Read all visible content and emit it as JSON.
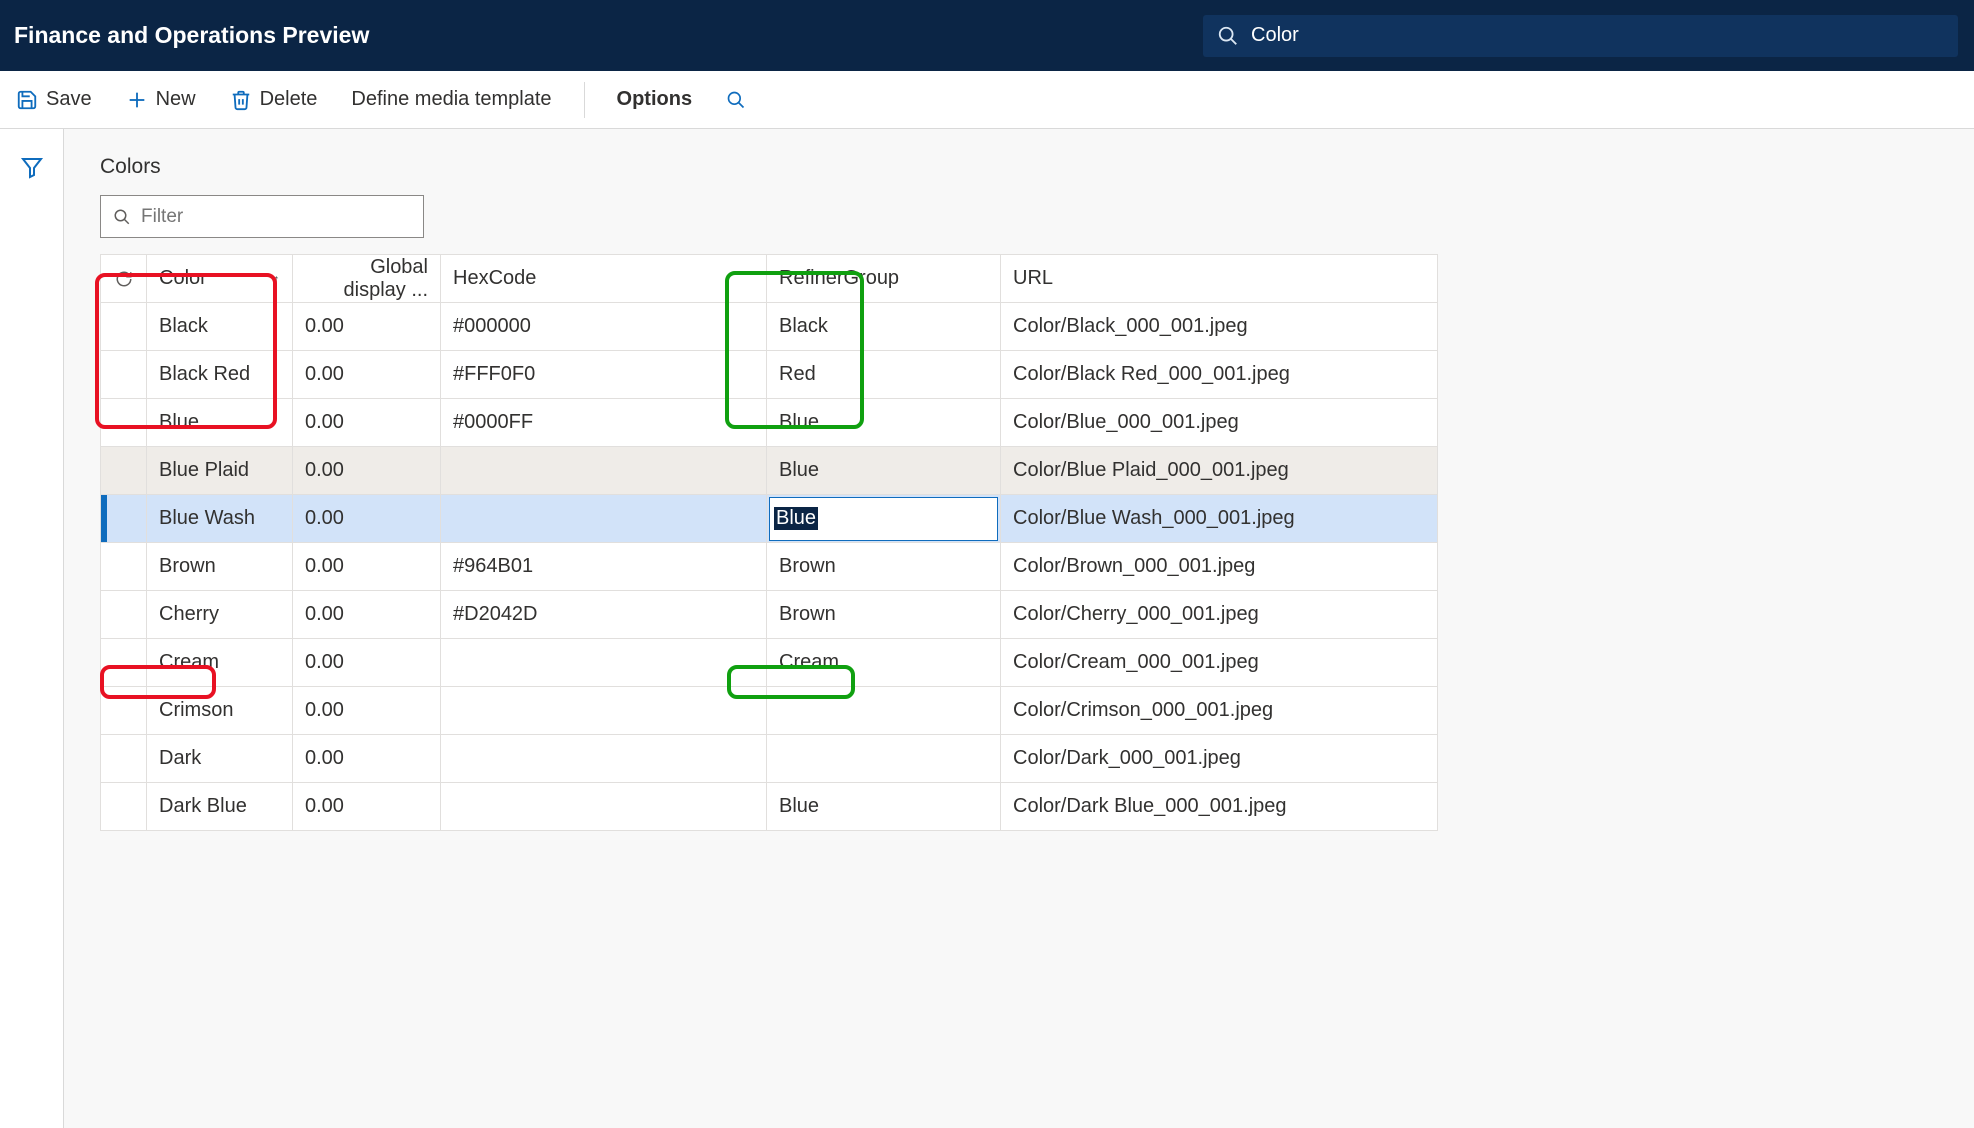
{
  "header": {
    "app_title": "Finance and Operations Preview",
    "search_value": "Color"
  },
  "cmdbar": {
    "save": "Save",
    "new": "New",
    "delete": "Delete",
    "define_media_template": "Define media template",
    "options": "Options"
  },
  "page": {
    "title": "Colors",
    "filter_placeholder": "Filter"
  },
  "grid": {
    "headers": {
      "color": "Color",
      "global_display": "Global display ...",
      "hexcode": "HexCode",
      "refiner_group": "RefinerGroup",
      "url": "URL"
    },
    "rows": [
      {
        "color": "Black",
        "disp": "0.00",
        "hex": "#000000",
        "refiner": "Black",
        "url": "Color/Black_000_001.jpeg"
      },
      {
        "color": "Black Red",
        "disp": "0.00",
        "hex": "#FFF0F0",
        "refiner": "Red",
        "url": "Color/Black Red_000_001.jpeg"
      },
      {
        "color": "Blue",
        "disp": "0.00",
        "hex": "#0000FF",
        "refiner": "Blue",
        "url": "Color/Blue_000_001.jpeg"
      },
      {
        "color": "Blue Plaid",
        "disp": "0.00",
        "hex": "",
        "refiner": "Blue",
        "url": "Color/Blue Plaid_000_001.jpeg",
        "alt": true
      },
      {
        "color": "Blue Wash",
        "disp": "0.00",
        "hex": "",
        "refiner": "Blue",
        "url": "Color/Blue Wash_000_001.jpeg",
        "selected": true,
        "editing": true
      },
      {
        "color": "Brown",
        "disp": "0.00",
        "hex": "#964B01",
        "refiner": "Brown",
        "url": "Color/Brown_000_001.jpeg"
      },
      {
        "color": "Cherry",
        "disp": "0.00",
        "hex": "#D2042D",
        "refiner": "Brown",
        "url": "Color/Cherry_000_001.jpeg"
      },
      {
        "color": "Cream",
        "disp": "0.00",
        "hex": "",
        "refiner": "Cream",
        "url": "Color/Cream_000_001.jpeg"
      },
      {
        "color": "Crimson",
        "disp": "0.00",
        "hex": "",
        "refiner": "",
        "url": "Color/Crimson_000_001.jpeg"
      },
      {
        "color": "Dark",
        "disp": "0.00",
        "hex": "",
        "refiner": "",
        "url": "Color/Dark_000_001.jpeg"
      },
      {
        "color": "Dark Blue",
        "disp": "0.00",
        "hex": "",
        "refiner": "Blue",
        "url": "Color/Dark Blue_000_001.jpeg"
      }
    ]
  }
}
